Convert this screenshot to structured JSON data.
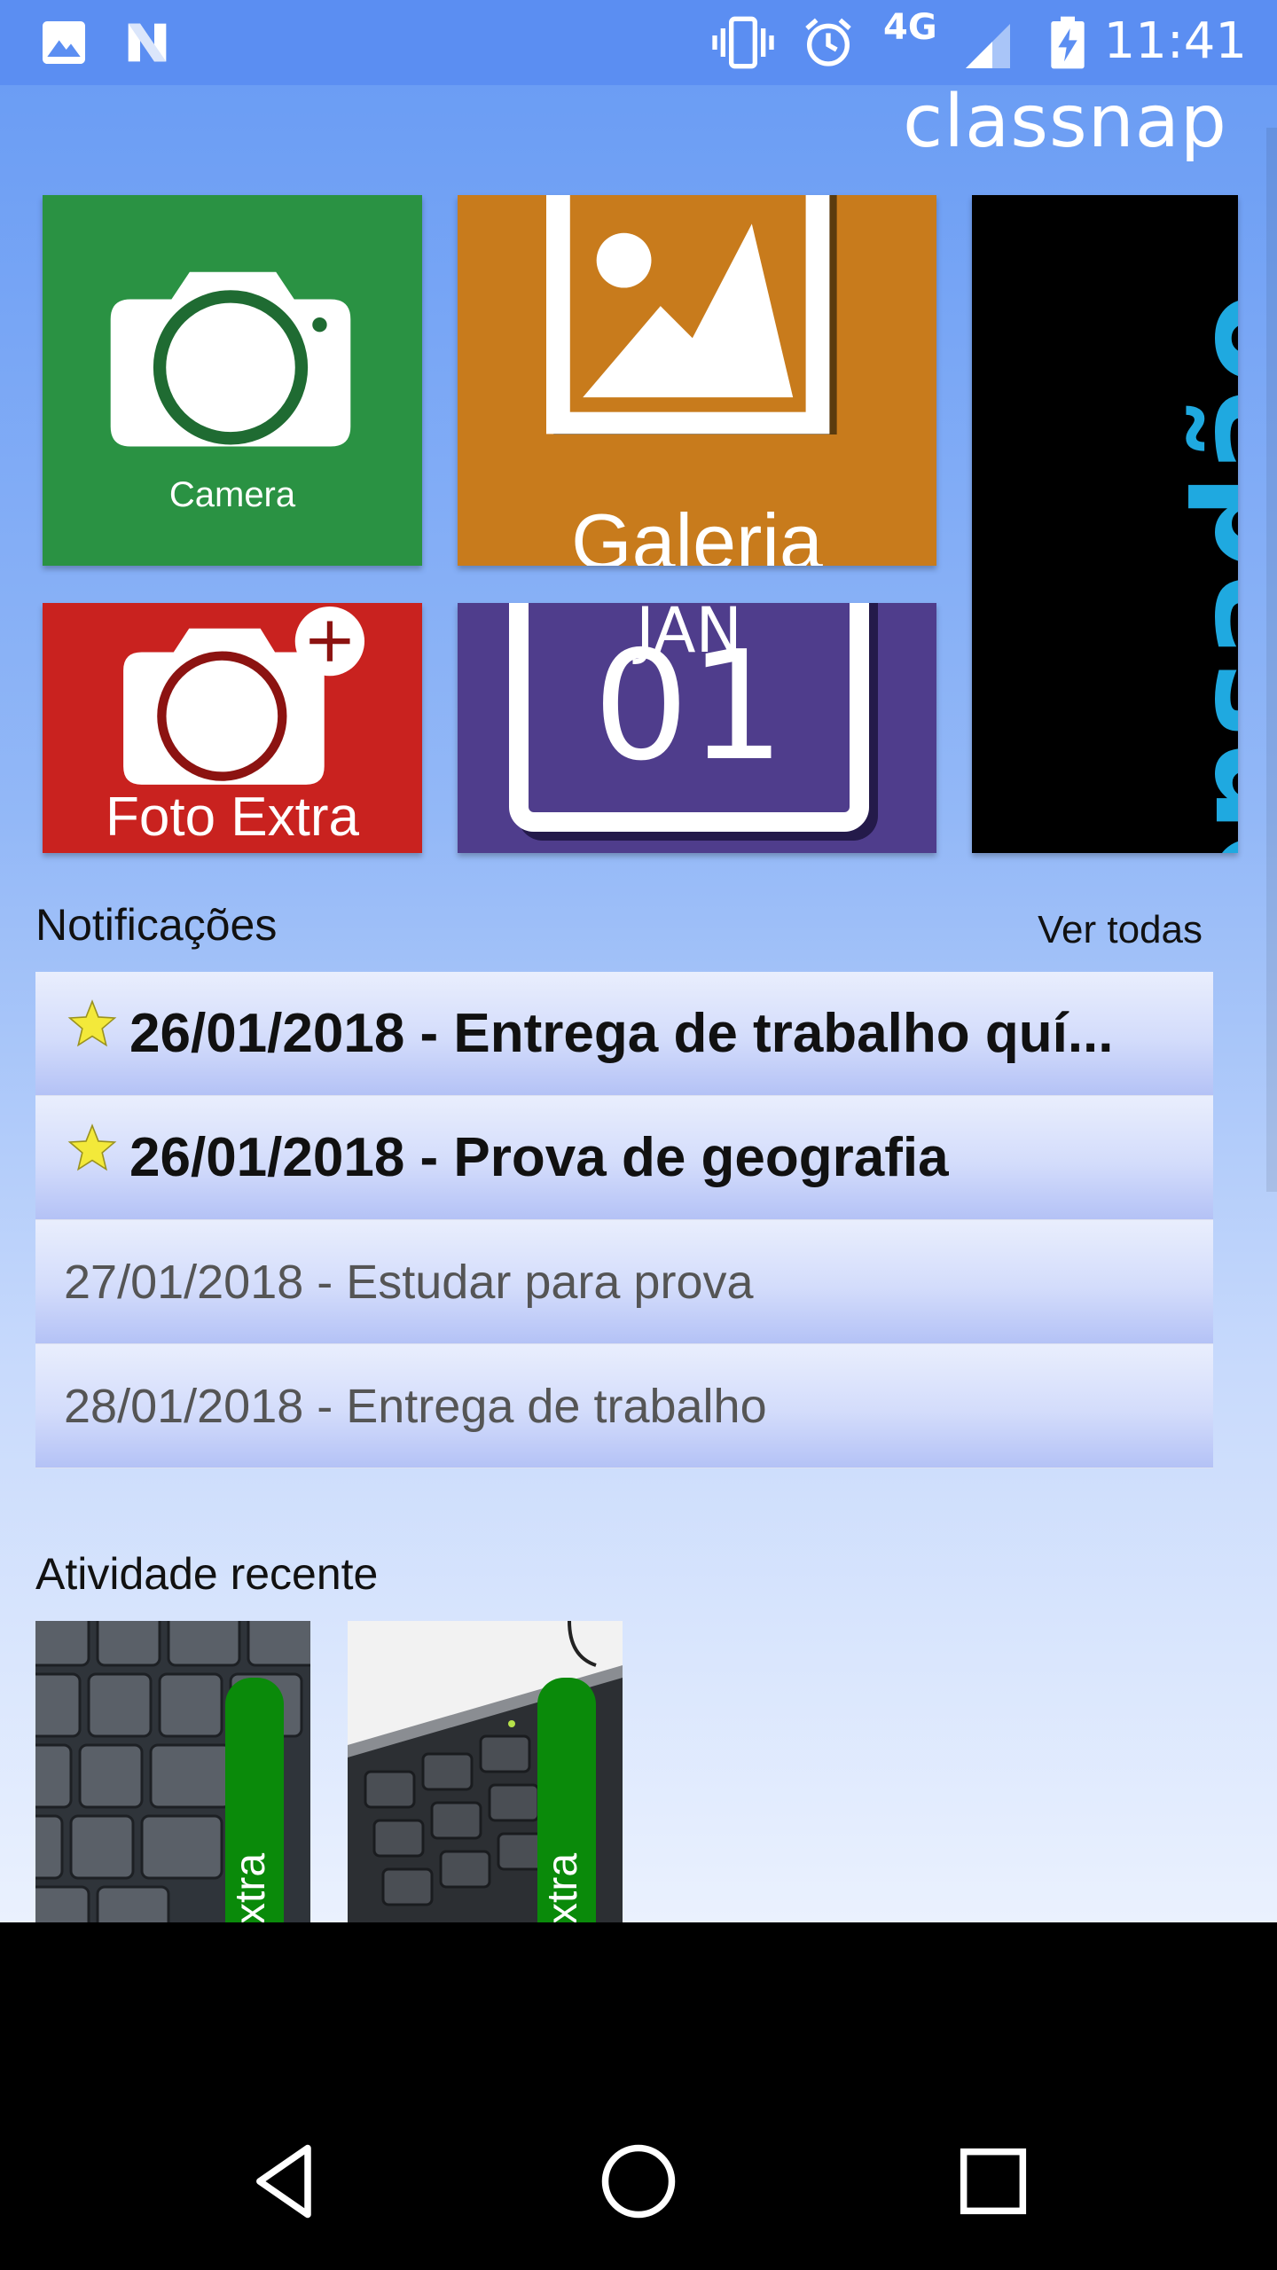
{
  "status_bar": {
    "time": "11:41",
    "network": "4G",
    "icons": [
      "image-icon",
      "n-logo-icon",
      "vibrate-icon",
      "alarm-icon",
      "signal-icon",
      "battery-charging-icon"
    ]
  },
  "app": {
    "title": "classnap"
  },
  "tiles": {
    "camera": {
      "label": "Camera",
      "color": "#2a9243"
    },
    "galeria": {
      "label": "Galeria",
      "color": "#c87b1c"
    },
    "foto_extra": {
      "label": "Foto Extra",
      "color": "#c9221f"
    },
    "calendar": {
      "month": "JAN",
      "day": "01",
      "color": "#4f3d8c"
    },
    "banner": {
      "text": "O Prensadão"
    }
  },
  "notifications": {
    "title": "Notificações",
    "see_all": "Ver todas",
    "items": [
      {
        "text": "26/01/2018 - Entrega de trabalho quí...",
        "important": true
      },
      {
        "text": "26/01/2018 - Prova de geografia",
        "important": true
      },
      {
        "text": "27/01/2018 - Estudar para prova",
        "important": false
      },
      {
        "text": "28/01/2018 - Entrega de trabalho",
        "important": false
      }
    ]
  },
  "recent": {
    "title": "Atividade recente",
    "items": [
      {
        "tag": "Extra"
      },
      {
        "tag": "Extra"
      }
    ]
  },
  "navigation": {
    "icons": [
      "back-icon",
      "home-icon",
      "recents-icon"
    ]
  }
}
